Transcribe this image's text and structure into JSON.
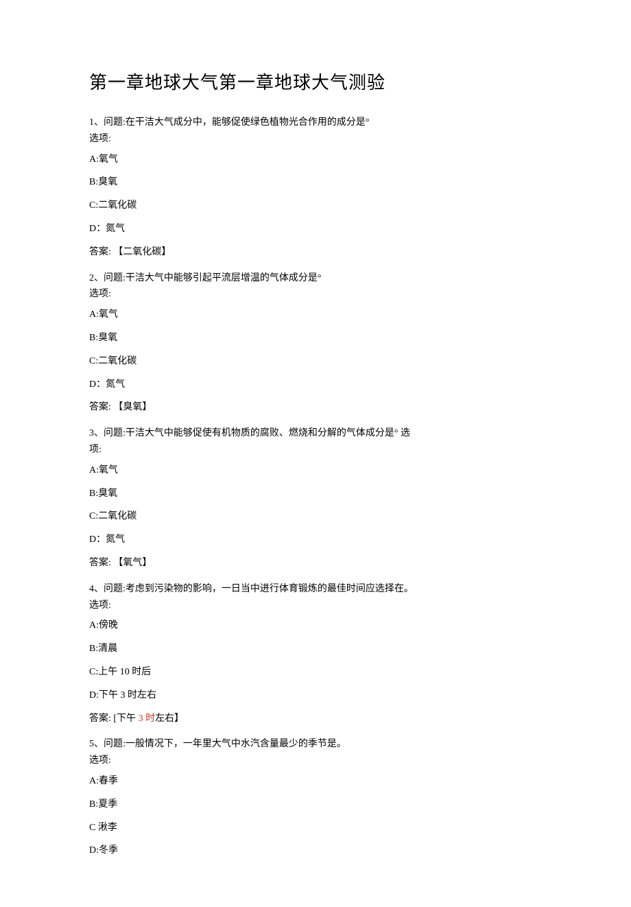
{
  "title": "第一章地球大气第一章地球大气测验",
  "answer_prefix": "答案:",
  "options_label": "选项:",
  "questions": [
    {
      "number": "1、",
      "label": "问题:",
      "text": "在干洁大气成分中，能够促使绿色植物光合作用的成分是°",
      "options": [
        {
          "key": "A:",
          "value": "氧气"
        },
        {
          "key": "B:",
          "value": "臭氧"
        },
        {
          "key": "C:",
          "value": "二氧化碳"
        },
        {
          "key": "D：",
          "value": "氮气"
        }
      ],
      "answer": "【二氧化碳】"
    },
    {
      "number": "2、",
      "label": "问题:",
      "text": "干洁大气中能够引起平流层增温的气体成分是°",
      "options": [
        {
          "key": "A:",
          "value": "氧气"
        },
        {
          "key": "B:",
          "value": "臭氧"
        },
        {
          "key": "C:",
          "value": "二氧化碳"
        },
        {
          "key": "D：",
          "value": "氮气"
        }
      ],
      "answer": "【臭氧】"
    },
    {
      "number": "3、",
      "label": "问题:",
      "text": "干洁大气中能够促使有机物质的腐败、燃烧和分解的气体成分是° 选",
      "options_label_override": "项:",
      "options": [
        {
          "key": "A:",
          "value": "氧气"
        },
        {
          "key": "B:",
          "value": "臭氧"
        },
        {
          "key": "C:",
          "value": "二氧化碳"
        },
        {
          "key": "D：",
          "value": "氮气"
        }
      ],
      "answer": "【氧气】"
    },
    {
      "number": "4、",
      "label": "问题:",
      "text": "考虑到污染物的影响，一日当中进行体育锻炼的最佳时间应选择在。",
      "options": [
        {
          "key": "A:",
          "value": "傍晚"
        },
        {
          "key": "B:",
          "value": "清晨"
        },
        {
          "key": "C:",
          "value": "上午 10 时后"
        },
        {
          "key": "D:",
          "value": "下午 3 时左右"
        }
      ],
      "answer_prefix_override": "答案:   [下午",
      "answer_highlight": " 3 时",
      "answer_suffix": "左右】"
    },
    {
      "number": "5、",
      "label": "问题:",
      "text": "一般情况下，一年里大气中水汽含量最少的季节是。",
      "options": [
        {
          "key": "A:",
          "value": "春季"
        },
        {
          "key": "B:",
          "value": "夏季"
        },
        {
          "key": "C ",
          "value": "湫李"
        },
        {
          "key": "D:",
          "value": "冬季"
        }
      ],
      "answer": null
    }
  ]
}
